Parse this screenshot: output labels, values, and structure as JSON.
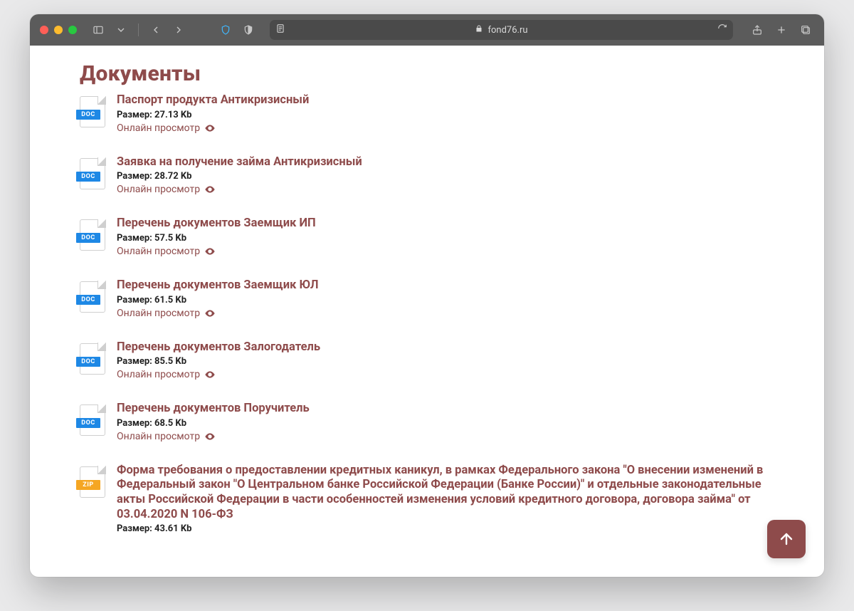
{
  "browser": {
    "url_host": "fond76.ru"
  },
  "page": {
    "title": "Документы",
    "size_label": "Размер:",
    "preview_label": "Онлайн просмотр"
  },
  "documents": [
    {
      "type": "doc",
      "title": "Паспорт продукта Антикризисный",
      "size": "27.13 Kb",
      "has_preview": true
    },
    {
      "type": "doc",
      "title": "Заявка на получение займа Антикризисный",
      "size": "28.72 Kb",
      "has_preview": true
    },
    {
      "type": "doc",
      "title": "Перечень документов Заемщик ИП",
      "size": "57.5 Kb",
      "has_preview": true
    },
    {
      "type": "doc",
      "title": "Перечень документов Заемщик ЮЛ",
      "size": "61.5 Kb",
      "has_preview": true
    },
    {
      "type": "doc",
      "title": "Перечень документов Залогодатель",
      "size": "85.5 Kb",
      "has_preview": true
    },
    {
      "type": "doc",
      "title": "Перечень документов Поручитель",
      "size": "68.5 Kb",
      "has_preview": true
    },
    {
      "type": "zip",
      "title": "Форма требования о предоставлении кредитных каникул, в рамках Федерального закона \"О внесении изменений в Федеральный закон \"О Центральном банке Российской Федерации (Банке России)\" и отдельные законодательные акты Российской Федерации в части особенностей изменения условий кредитного договора, договора займа\" от 03.04.2020 N 106-ФЗ",
      "size": "43.61 Kb",
      "has_preview": false
    }
  ]
}
